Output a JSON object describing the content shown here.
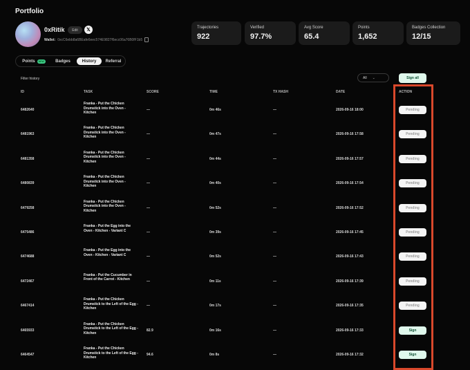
{
  "page": {
    "title": "Portfolio"
  },
  "profile": {
    "username": "0xRitik",
    "edit_label": "Edit",
    "x_icon_label": "𝕏",
    "wallet_label": "Wallet:",
    "wallet_address": "0xcC6ebb8a6BEafe6eec574E9827f6ecc06a76B0fF1b5"
  },
  "stats": [
    {
      "label": "Trajectories",
      "value": "922"
    },
    {
      "label": "Verified",
      "value": "97.7%"
    },
    {
      "label": "Avg Score",
      "value": "65.4"
    },
    {
      "label": "Points",
      "value": "1,652"
    },
    {
      "label": "Badges Collection",
      "value": "12/15"
    }
  ],
  "tabs": [
    {
      "label": "Points",
      "badge": "NEW"
    },
    {
      "label": "Badges"
    },
    {
      "label": "History",
      "active": true
    },
    {
      "label": "Referral"
    }
  ],
  "filter": {
    "label": "Filter history",
    "select_value": "All",
    "sign_all_label": "Sign all"
  },
  "table": {
    "headers": [
      "ID",
      "TASK",
      "SCORE",
      "TIME",
      "TX HASH",
      "DATE",
      "ACTION"
    ],
    "rows": [
      {
        "id": "6482640",
        "task": "Franka - Put the Chicken Drumstick into the Oven - Kitchen",
        "score": "—",
        "time": "0m 46s",
        "tx": "—",
        "date": "2026-09-16 18:00",
        "action": "Pending"
      },
      {
        "id": "6481963",
        "task": "Franka - Put the Chicken Drumstick into the Oven - Kitchen",
        "score": "—",
        "time": "0m 47s",
        "tx": "—",
        "date": "2026-09-16 17:58",
        "action": "Pending"
      },
      {
        "id": "6481358",
        "task": "Franka - Put the Chicken Drumstick into the Oven - Kitchen",
        "score": "—",
        "time": "0m 44s",
        "tx": "—",
        "date": "2026-09-16 17:57",
        "action": "Pending"
      },
      {
        "id": "6480839",
        "task": "Franka - Put the Chicken Drumstick into the Oven - Kitchen",
        "score": "—",
        "time": "0m 40s",
        "tx": "—",
        "date": "2026-09-16 17:54",
        "action": "Pending"
      },
      {
        "id": "6479258",
        "task": "Franka - Put the Chicken Drumstick into the Oven - Kitchen",
        "score": "—",
        "time": "0m 52s",
        "tx": "—",
        "date": "2026-09-16 17:52",
        "action": "Pending"
      },
      {
        "id": "6475486",
        "task": "Franka - Put the Egg into the Oven - Kitchen - Variant C",
        "score": "—",
        "time": "0m 39s",
        "tx": "—",
        "date": "2026-09-16 17:45",
        "action": "Pending"
      },
      {
        "id": "6474688",
        "task": "Franka - Put the Egg into the Oven - Kitchen - Variant C",
        "score": "—",
        "time": "0m 52s",
        "tx": "—",
        "date": "2026-09-16 17:43",
        "action": "Pending"
      },
      {
        "id": "6472467",
        "task": "Franka - Put the Cucumber in Front of the Carrot - Kitchen",
        "score": "—",
        "time": "0m 11s",
        "tx": "—",
        "date": "2026-09-16 17:39",
        "action": "Pending"
      },
      {
        "id": "6467414",
        "task": "Franka - Put the Chicken Drumstick to the Left of the Egg - Kitchen",
        "score": "—",
        "time": "0m 17s",
        "tx": "—",
        "date": "2026-09-16 17:35",
        "action": "Pending"
      },
      {
        "id": "6465933",
        "task": "Franka - Put the Chicken Drumstick to the Left of the Egg - Kitchen",
        "score": "82.9",
        "time": "0m 16s",
        "tx": "—",
        "date": "2026-09-16 17:33",
        "action": "Sign"
      },
      {
        "id": "6464547",
        "task": "Franka - Put the Chicken Drumstick to the Left of the Egg - Kitchen",
        "score": "94.6",
        "time": "0m 8s",
        "tx": "—",
        "date": "2026-09-16 17:32",
        "action": "Sign"
      }
    ]
  },
  "colors": {
    "background": "#070707",
    "card": "#1b1b1b",
    "sign_bg": "#dff8ec",
    "highlight": "#d9482b"
  }
}
